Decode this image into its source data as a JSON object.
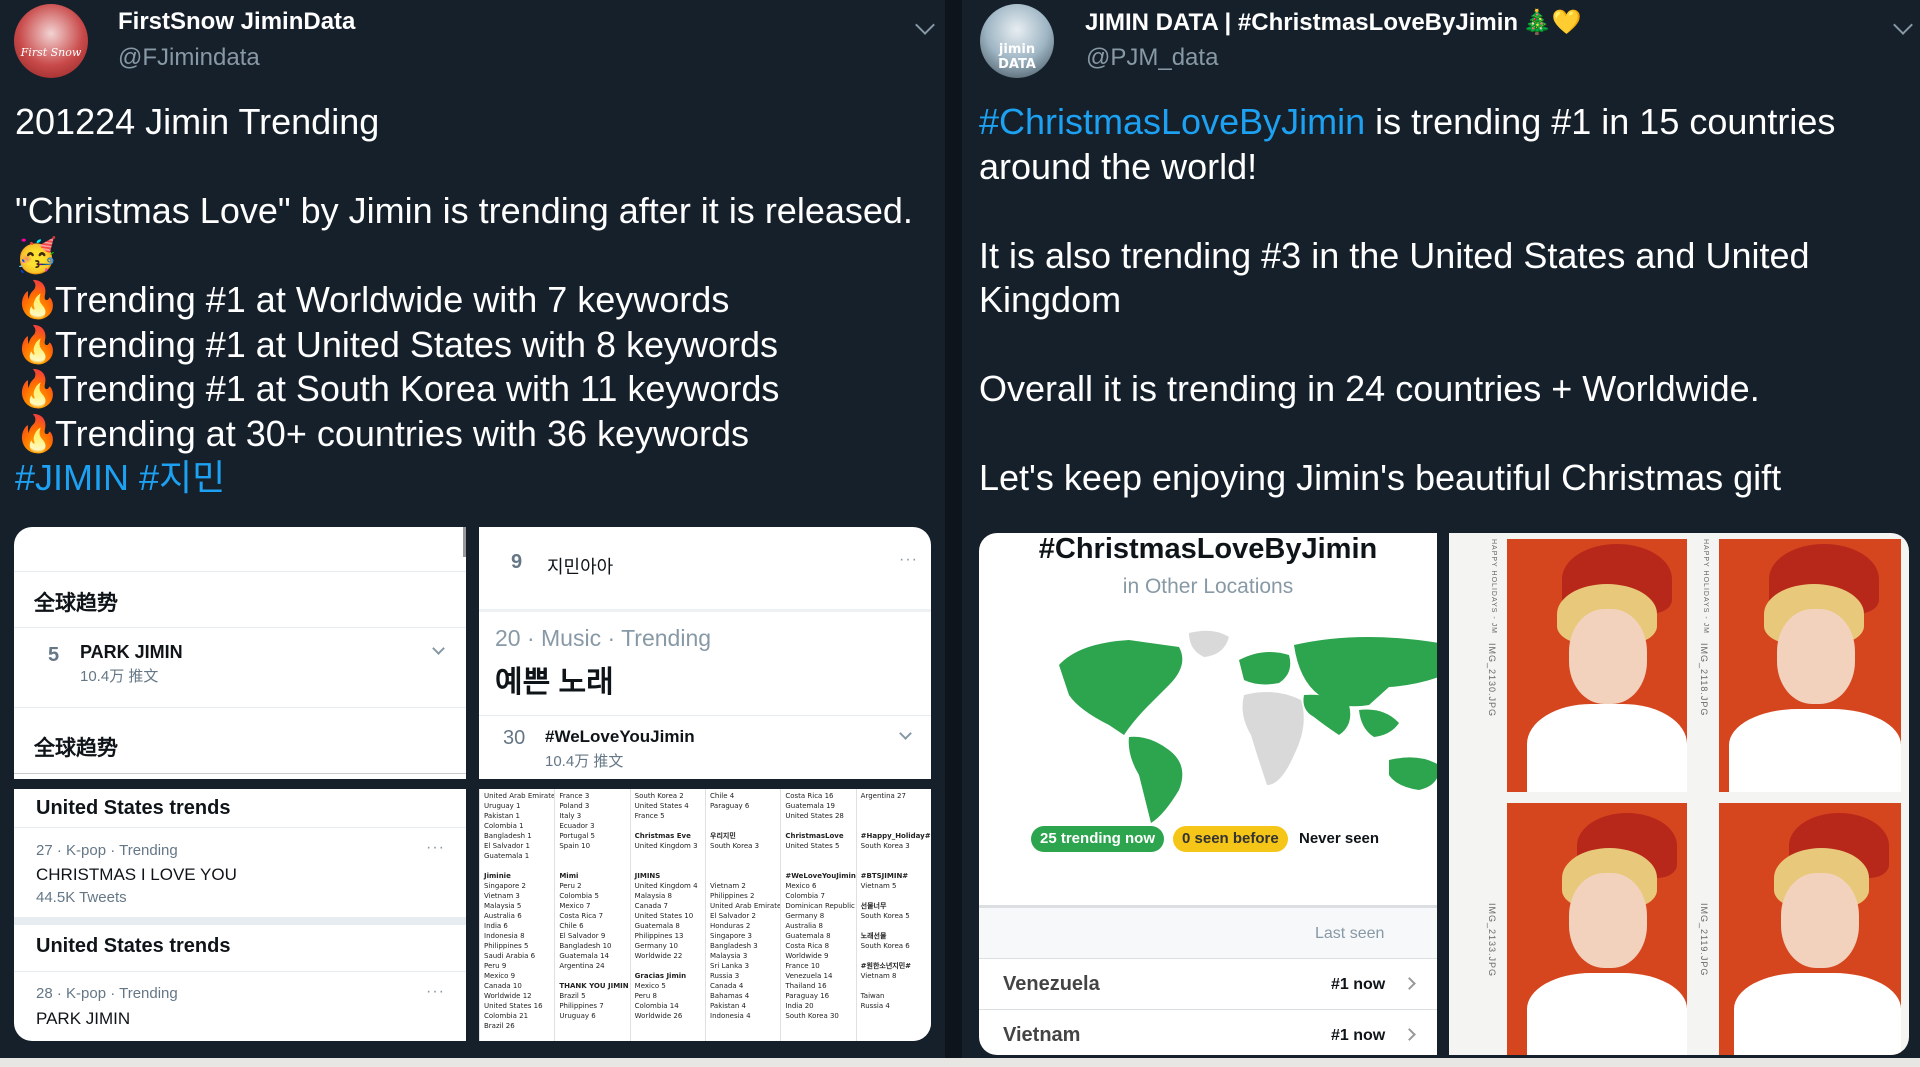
{
  "left_tweet": {
    "display_name": "FirstSnow JiminData",
    "handle": "@FJimindata",
    "avatar_text": "First Snow",
    "lines": [
      "201224 Jimin Trending",
      "\"Christmas Love\" by Jimin is trending after it is released.",
      "🥳",
      "Trending #1 at Worldwide with 7 keywords",
      "Trending #1 at United States with 8 keywords",
      "Trending #1 at South Korea with 11 keywords",
      "Trending at 30+ countries with 36 keywords"
    ],
    "fire_icon": "🔥",
    "hashtags": "#JIMIN #지민",
    "media": {
      "cn_panel": {
        "header1": "全球趋势",
        "rank": "5",
        "name": "PARK JIMIN",
        "count": "10.4万 推文",
        "header2": "全球趋势"
      },
      "kr_panel": {
        "rank": "9",
        "name": "지민아아",
        "trend_meta": "20 · Music · Trending",
        "trend_name": "예쁜 노래",
        "rank2": "30",
        "hashtag": "#WeLoveYouJimin",
        "count": "10.4万 推文"
      },
      "us_panel": {
        "header1": "United States trends",
        "meta1": "27 · K-pop · Trending",
        "name1": "CHRISTMAS I LOVE YOU",
        "count1": "44.5K Tweets",
        "header2": "United States trends",
        "meta2": "28 · K-pop · Trending",
        "name2": "PARK JIMIN"
      },
      "table_columns": [
        [
          "United Arab Emirates 1",
          "Uruguay 1",
          "Pakistan 1",
          "Colombia 1",
          "Bangladesh 1",
          "El Salvador 1",
          "Guatemala 1",
          "",
          "Jiminie",
          "Singapore 2",
          "Vietnam 3",
          "Malaysia 5",
          "Australia 6",
          "India 6",
          "Indonesia 8",
          "Philippines 5",
          "Saudi Arabia 6",
          "Peru 9",
          "Mexico 9",
          "Canada 10",
          "Worldwide 12",
          "United States 16",
          "Colombia 21",
          "Brazil 26"
        ],
        [
          "France 3",
          "Poland 3",
          "Italy 3",
          "Ecuador 3",
          "Portugal 5",
          "Spain 10",
          "",
          "",
          "Mimi",
          "Peru 2",
          "Colombia 5",
          "Mexico 7",
          "Costa Rica 7",
          "Chile 6",
          "El Salvador 9",
          "Bangladesh 10",
          "Guatemala 14",
          "Argentina 24",
          "",
          "THANK YOU JIMIN",
          "Brazil 5",
          "Philippines 7",
          "Uruguay 6"
        ],
        [
          "South Korea 2",
          "United States 4",
          "France 5",
          "",
          "Christmas Eve",
          "United Kingdom 3",
          "",
          "",
          "JIMINS",
          "United Kingdom 4",
          "Malaysia 8",
          "Canada 7",
          "United States 10",
          "Guatemala 8",
          "Philippines 13",
          "Germany 10",
          "Worldwide 22",
          "",
          "Gracias Jimin",
          "Mexico 5",
          "Peru 8",
          "Colombia 14",
          "Worldwide 26"
        ],
        [
          "Chile 4",
          "Paraguay 6",
          "",
          "",
          "우리지민",
          "South Korea 3",
          "",
          "",
          "",
          "Vietnam 2",
          "Philippines 2",
          "United Arab Emirates 2",
          "El Salvador 2",
          "Honduras 2",
          "Singapore 3",
          "Bangladesh 3",
          "Malaysia 3",
          "Sri Lanka 3",
          "Russia 3",
          "Canada 4",
          "Bahamas 4",
          "Pakistan 4",
          "Indonesia 4"
        ],
        [
          "Costa Rica 16",
          "Guatemala 19",
          "United States 28",
          "",
          "ChristmasLove",
          "United States 5",
          "",
          "",
          "#WeLoveYouJimin#",
          "Mexico 6",
          "Colombia 7",
          "Dominican Republic 7",
          "Germany 8",
          "Australia 8",
          "Guatemala 8",
          "Costa Rica 8",
          "Worldwide 9",
          "France 10",
          "Venezuela 14",
          "Thailand 16",
          "Paraguay 16",
          "India 20",
          "South Korea 30"
        ],
        [
          "Argentina 27",
          "",
          "",
          "",
          "#Happy_Holiday#",
          "South Korea 3",
          "",
          "",
          "#BTSJIMIN#",
          "Vietnam 5",
          "",
          "선물너무",
          "South Korea 5",
          "",
          "노래선물",
          "South Korea 6",
          "",
          "#원한소년지민#",
          "Vietnam 8",
          "",
          "Taiwan",
          "Russia 4"
        ]
      ]
    }
  },
  "right_tweet": {
    "display_name": "JIMIN DATA | #ChristmasLoveByJimin",
    "name_emojis": "🎄💛",
    "handle": "@PJM_data",
    "avatar_text": "jimin DATA",
    "hashtag_lead": "#ChristmasLoveByJimin",
    "line1_rest": " is trending #1 in 15 countries",
    "line2": "around the world!",
    "line3": "It is also trending #3 in the United States and United",
    "line4": "Kingdom",
    "line5": "Overall it is trending in 24 countries + Worldwide.",
    "line6": "Let's keep enjoying Jimin's beautiful Christmas gift",
    "map_card": {
      "title": "#ChristmasLoveByJimin",
      "subtitle": "in Other Locations",
      "pill_trending": "25 trending now",
      "pill_seen": "0 seen before",
      "pill_never": "Never seen",
      "last_seen_label": "Last seen",
      "rows": [
        {
          "country": "Venezuela",
          "status": "#1 now"
        },
        {
          "country": "Vietnam",
          "status": "#1 now"
        }
      ],
      "colors": {
        "trending": "#2da44e",
        "seen": "#f5c518",
        "never": "#d9d9d9"
      }
    },
    "photo_labels": [
      "IMG_2130.JPG",
      "IMG_2118.JPG",
      "IMG_2133.JPG",
      "IMG_2119.JPG"
    ],
    "photo_strip_text": "HAPPY HOLIDAYS - JM"
  }
}
